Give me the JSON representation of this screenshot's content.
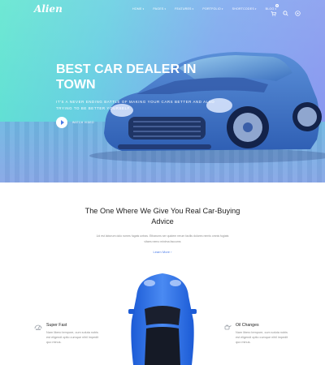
{
  "brand": {
    "logo": "Alien",
    "accent": "#4a7be8"
  },
  "nav": {
    "items": [
      {
        "label": "HOME",
        "caret": "▾"
      },
      {
        "label": "PAGES",
        "caret": "▾"
      },
      {
        "label": "FEATURES",
        "caret": "▾"
      },
      {
        "label": "PORTFOLIO",
        "caret": "▾"
      },
      {
        "label": "SHORTCODES",
        "caret": "▾"
      },
      {
        "label": "BLOG",
        "caret": "▾"
      }
    ],
    "icons": [
      "cart-icon",
      "search-icon",
      "menu-icon"
    ],
    "cart_count": "0"
  },
  "hero": {
    "title": "BEST CAR DEALER IN TOWN",
    "subtitle": "IT'S A NEVER ENDING BATTLE OF MAKING YOUR CARS BETTER AND ALSO TRYING TO BE BETTER YOURSELF.",
    "play_label": "WATCH VIDEO",
    "gradient": [
      "#5fe6cf",
      "#7da9ee",
      "#8a95f0"
    ]
  },
  "advice": {
    "title": "The One Where We Give You Real Car-Buying Advice",
    "text": "Lid est laborum dolo rumes fugats untras. Etharums ser quidem rerum facilis dolores nemis omnis fugiats vitaes nemo minima faccums",
    "learn_more": "Learn More ›"
  },
  "features": [
    {
      "title": "Super Fast",
      "icon": "speedometer-icon",
      "text": "Nam libero tempore, cum soluta nobis est eligendi optio cumque nihil impedit quo minus."
    },
    {
      "title": "Oil Changes",
      "icon": "oil-can-icon",
      "text": "Nam libero tempore, cum soluta nobis est eligendi optio cumque nihil impedit quo minus."
    }
  ]
}
